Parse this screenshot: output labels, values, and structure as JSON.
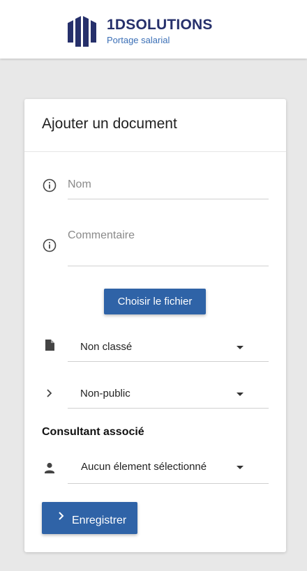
{
  "brand": {
    "name": "1DSOLUTIONS",
    "tagline": "Portage salarial",
    "primary_color": "#26306b",
    "accent_color": "#3b6fb6"
  },
  "form": {
    "title": "Ajouter un document",
    "nom_placeholder": "Nom",
    "commentaire_placeholder": "Commentaire",
    "choose_file_label": "Choisir le fichier",
    "category_value": "Non classé",
    "visibility_value": "Non-public",
    "consultant_section_label": "Consultant associé",
    "consultant_value": "Aucun élement sélectionné",
    "save_label": "Enregistrer"
  },
  "icons": {
    "nom": "info-icon",
    "commentaire": "info-icon",
    "category": "file-icon",
    "visibility": "chevron-right-icon",
    "consultant": "person-icon",
    "save": "chevron-right-icon"
  },
  "colors": {
    "button": "#2f63a7",
    "background": "#e8e8e8"
  }
}
